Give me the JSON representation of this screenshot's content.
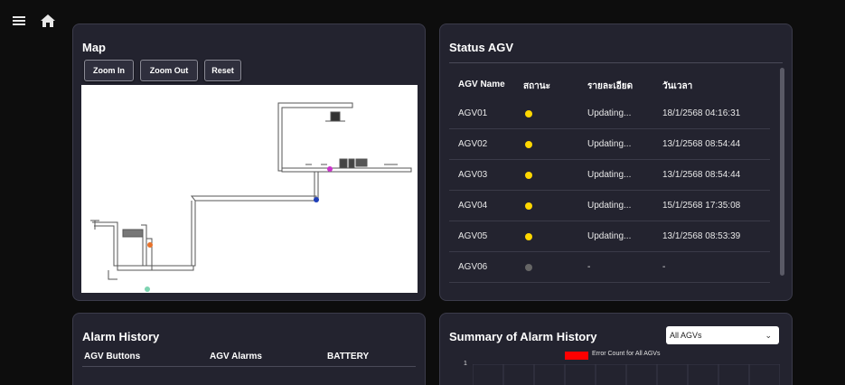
{
  "topbar": {
    "menu_icon": "menu-icon",
    "home_icon": "home-icon"
  },
  "map": {
    "title": "Map",
    "buttons": {
      "zoom_in": "Zoom In",
      "zoom_out": "Zoom Out",
      "reset": "Reset"
    }
  },
  "status": {
    "title": "Status AGV",
    "headers": {
      "name": "AGV Name",
      "state": "สถานะ",
      "detail": "รายละเอียด",
      "time": "วันเวลา"
    },
    "rows": [
      {
        "name": "AGV01",
        "status_color": "#ffd700",
        "detail": "Updating...",
        "time": "18/1/2568 04:16:31"
      },
      {
        "name": "AGV02",
        "status_color": "#ffd700",
        "detail": "Updating...",
        "time": "13/1/2568 08:54:44"
      },
      {
        "name": "AGV03",
        "status_color": "#ffd700",
        "detail": "Updating...",
        "time": "13/1/2568 08:54:44"
      },
      {
        "name": "AGV04",
        "status_color": "#ffd700",
        "detail": "Updating...",
        "time": "15/1/2568 17:35:08"
      },
      {
        "name": "AGV05",
        "status_color": "#ffd700",
        "detail": "Updating...",
        "time": "13/1/2568 08:53:39"
      },
      {
        "name": "AGV06",
        "status_color": "#666666",
        "detail": "-",
        "time": "-"
      }
    ]
  },
  "alarm_history": {
    "title": "Alarm History",
    "columns": {
      "buttons": "AGV Buttons",
      "alarms": "AGV Alarms",
      "battery": "BATTERY"
    }
  },
  "summary": {
    "title": "Summary of Alarm History",
    "select_value": "All AGVs",
    "legend": "Error Count for All AGVs",
    "legend_color": "#ff0000",
    "y_tick": "1"
  }
}
